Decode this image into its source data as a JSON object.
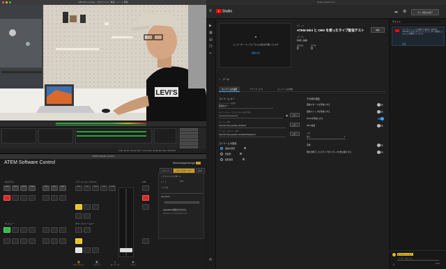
{
  "obs": {
    "window_title": "OBS 26.1.2 (mac) - プロファイル: 無題 - シーン: 無題",
    "status": "FPS: 30.00 / 30.00   CPU: 9.7%   REC: 00:00:00   LIVE: 00:00:00"
  },
  "atem": {
    "window_title": "ATEM Software Control",
    "app_name": "ATEM Software Control",
    "brand": "Blackmagicdesign",
    "sections": {
      "program_label": "プログラム",
      "preview_label": "プレビュー",
      "fade_label": "フェード",
      "mix_label": "ミックス",
      "transition_label": "トランジションスタイル",
      "next_label": "ネクスト トランジション",
      "ftb_label": "FTB",
      "dsk_label": "ダウンストリームキー"
    },
    "program_buttons": [
      "Cam1",
      "Cam2",
      "Cam3",
      "Cam4",
      "Still",
      "Blk",
      "Bars"
    ],
    "preview_buttons": [
      "Cam1",
      "Cam2",
      "Cam3",
      "Cam4",
      "Still",
      "Blk",
      "Bars"
    ],
    "transition_buttons": [
      "MIX",
      "DIP",
      "WIPE",
      "DVE",
      "STING"
    ],
    "right_tabs": [
      "パレット",
      "メディアプレーヤー",
      "出力"
    ],
    "right_panel": {
      "section": "トランジションスタイル",
      "rate_label": "レート",
      "rate_value": "1:00",
      "mix_label": "ミックス",
      "hyperdeck_label": "HyperDeck",
      "hyperdeck_status": "HyperDeckが検出されません",
      "hyperdeck_hint": "Manage your HyperDeck here"
    },
    "bottom_nav": [
      "スイッチャー",
      "メディア",
      "オーディオ",
      "カメラ"
    ]
  },
  "browser": {
    "url": "studio.youtube.com"
  },
  "yt": {
    "logo": "Studio",
    "end_stream_label": "ライブ配信を終了",
    "rail_icons": [
      "video-icon",
      "grid-icon",
      "calendar-icon",
      "copy-icon",
      "clip-icon",
      "heart-icon"
    ],
    "preview": {
      "text": "エンコーダーソフトウェアからの接続を待機しています",
      "link": "詳細を表示"
    },
    "stream": {
      "title_label": "タイトル",
      "title": "ATEM Mini と OBS を使ったライブ配信テスト",
      "category_label": "カテゴリ",
      "category": "科学と技術",
      "viewers_label": "視聴回数",
      "viewers": "0",
      "likes_label": "高評価",
      "likes": "0",
      "edit_label": "編集"
    },
    "data_label": "データ",
    "tabs": [
      "ストリームの設定",
      "アナリティクス",
      "ストリームの状態"
    ],
    "key_section": {
      "title": "ストリーム キー",
      "select_label": "ストリームキーを選択",
      "select_value": "既定のキー",
      "key_label": "ストリームキー（エンコーダーに貼り付け）",
      "key_value": "••••••••••••••••••••••••••••",
      "copy_label": "コピー",
      "url_label": "ストリームURL",
      "url_value": "rtmp://a.rtmp.youtube.com/live2",
      "backup_label": "バックアップサーバーURL",
      "backup_value": "rtmp://b.rtmp.youtube.com/live2?backup=1"
    },
    "latency": {
      "title": "ストリームの遅延",
      "options": [
        "通常の遅延",
        "低遅延",
        "超低遅延"
      ]
    },
    "settings": {
      "title": "その他の設定",
      "toggles": [
        {
          "label": "自動スタートを有効にする",
          "on": false
        },
        {
          "label": "自動ストップを有効にする",
          "on": false
        },
        {
          "label": "DVR を有効にする",
          "on": true
        },
        {
          "label": "360° 動画",
          "on": false
        }
      ],
      "caption_label": "字幕",
      "caption_value": "なし",
      "toggles2": [
        {
          "label": "字幕",
          "on": false
        },
        {
          "label": "配信が終了したらライブのリプレイを非公開にする",
          "on": false
        }
      ]
    },
    "chat": {
      "title": "チャット",
      "card_text": "ライブストリームで字幕付きで配信する場合は、YouTube のスタジオでライブ エンコーダーを使用していることを確認してください",
      "card_link": "詳細",
      "username": "佐々木ちゃんねる",
      "input_placeholder": "メッセージを入力...",
      "count": "0/200"
    }
  }
}
